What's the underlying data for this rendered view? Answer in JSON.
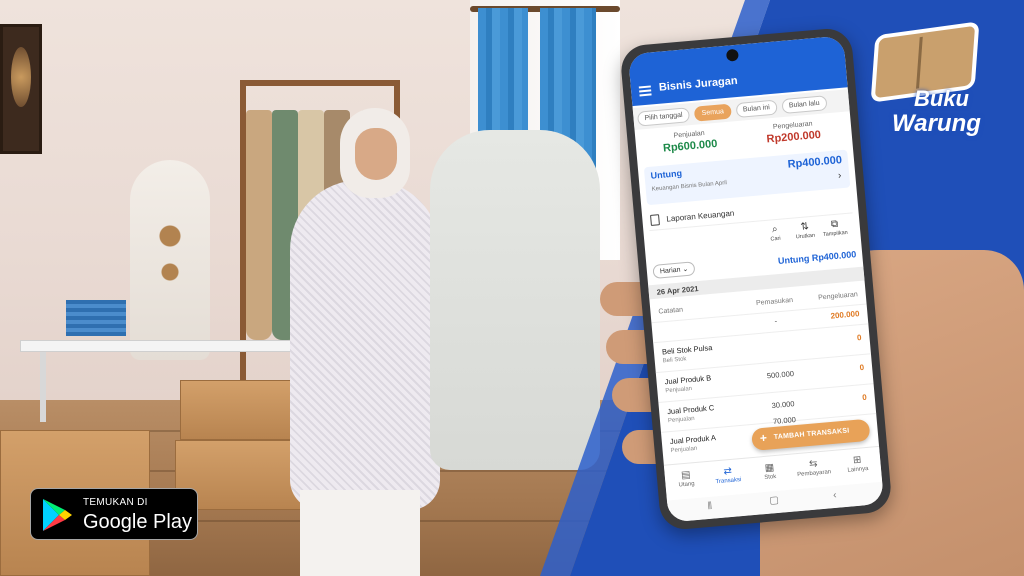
{
  "banner": {
    "logo": {
      "line1": "Buku",
      "line2": "Warung"
    },
    "store_badge": {
      "small_text": "TEMUKAN DI",
      "big_text": "Google Play",
      "icon": "google-play-icon"
    }
  },
  "app": {
    "title": "Bisnis Juragan",
    "menu_icon": "hamburger-menu-icon",
    "filters": [
      "Pilih tanggal",
      "Semua",
      "Bulan ini",
      "Bulan lalu"
    ],
    "active_filter": "Semua",
    "summary": {
      "income_label": "Penjualan",
      "income_value": "Rp600.000",
      "expense_label": "Pengeluaran",
      "expense_value": "Rp200.000",
      "profit_label": "Untung",
      "profit_value": "Rp400.000",
      "profit_note": "Keuangan Bisnis Bulan April"
    },
    "report": {
      "label": "Laporan Keuangan",
      "icon": "report-icon"
    },
    "tools": [
      {
        "label": "Cari",
        "icon": "search-icon"
      },
      {
        "label": "Urutkan",
        "icon": "sort-icon"
      },
      {
        "label": "Tampilkan",
        "icon": "display-icon"
      }
    ],
    "period_select": "Harian",
    "daily_profit": "Untung Rp400.000",
    "date": "26 Apr 2021",
    "table_headers": {
      "note": "Catatan",
      "in": "Pemasukan",
      "out": "Pengeluaran"
    },
    "transactions": [
      {
        "name": "",
        "category": "",
        "in": "-",
        "out": "200.000"
      },
      {
        "name": "Beli Stok Pulsa",
        "category": "Beli Stok",
        "in": "",
        "out": "0"
      },
      {
        "name": "Jual Produk B",
        "category": "Penjualan",
        "in": "500.000",
        "out": "0"
      },
      {
        "name": "Jual Produk C",
        "category": "Penjualan",
        "in": "30.000",
        "out": "0"
      },
      {
        "name": "Jual Produk A",
        "category": "Penjualan",
        "in": "70.000",
        "out": ""
      }
    ],
    "fab_label": "TAMBAH TRANSAKSI",
    "bottom_nav": [
      {
        "label": "Utang",
        "icon": "debt-icon"
      },
      {
        "label": "Transaksi",
        "icon": "transaction-icon"
      },
      {
        "label": "Stok",
        "icon": "stock-icon"
      },
      {
        "label": "Pembayaran",
        "icon": "payment-icon"
      },
      {
        "label": "Lainnya",
        "icon": "more-icon"
      }
    ],
    "active_nav": "Transaksi",
    "colors": {
      "primary": "#1e63d6",
      "accent": "#e8a258",
      "banner_blue": "#1f4fb8"
    }
  }
}
